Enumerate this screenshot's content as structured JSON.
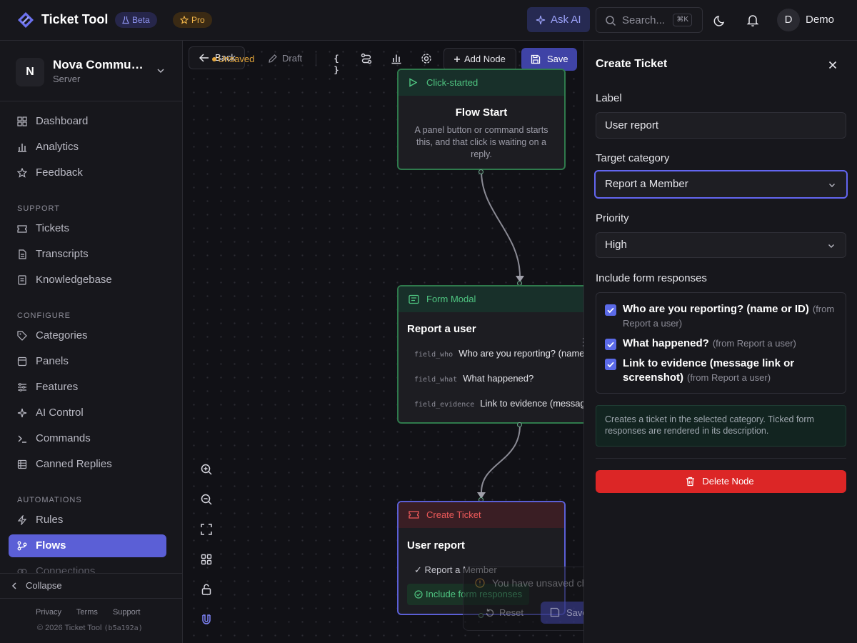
{
  "topbar": {
    "app_title": "Ticket Tool",
    "beta_badge": "Beta",
    "pro_badge": "Pro",
    "ask_ai_label": "Ask AI",
    "search_placeholder": "Search...",
    "search_shortcut": "⌘K",
    "user_initial": "D",
    "user_name": "Demo"
  },
  "sidebar": {
    "server_initial": "N",
    "server_name": "Nova Community",
    "server_type": "Server",
    "top_items": [
      {
        "label": "Dashboard",
        "icon": "dashboard-icon"
      },
      {
        "label": "Analytics",
        "icon": "bar-chart-icon"
      },
      {
        "label": "Feedback",
        "icon": "star-icon"
      }
    ],
    "sections": [
      {
        "title": "SUPPORT",
        "items": [
          {
            "label": "Tickets",
            "icon": "ticket-icon"
          },
          {
            "label": "Transcripts",
            "icon": "file-icon"
          },
          {
            "label": "Knowledgebase",
            "icon": "book-icon"
          }
        ]
      },
      {
        "title": "CONFIGURE",
        "items": [
          {
            "label": "Categories",
            "icon": "tag-icon"
          },
          {
            "label": "Panels",
            "icon": "panel-icon"
          },
          {
            "label": "Features",
            "icon": "sliders-icon"
          },
          {
            "label": "AI Control",
            "icon": "sparkle-icon"
          },
          {
            "label": "Commands",
            "icon": "terminal-icon"
          },
          {
            "label": "Canned Replies",
            "icon": "list-icon"
          }
        ]
      },
      {
        "title": "AUTOMATIONS",
        "items": [
          {
            "label": "Rules",
            "icon": "zap-icon"
          },
          {
            "label": "Flows",
            "icon": "flow-icon",
            "active": true
          },
          {
            "label": "Connections",
            "icon": "link-icon"
          }
        ]
      }
    ],
    "collapse_label": "Collapse",
    "footer_links": [
      "Privacy",
      "Terms",
      "Support"
    ],
    "copyright": "© 2026 Ticket Tool",
    "build": "(b5a192a)"
  },
  "canvas": {
    "back_label": "Back",
    "status_unsaved": "Unsaved",
    "status_draft": "Draft",
    "json_icon_text": "{ }",
    "add_node_label": "Add Node",
    "save_label": "Save",
    "nodes": {
      "start": {
        "type_label": "Click-started",
        "title": "Flow Start",
        "description": "A panel button or command starts this, and that click is waiting on a reply."
      },
      "form": {
        "type_label": "Form Modal",
        "title": "Report a user",
        "fields": [
          {
            "key": "field_who",
            "label": "Who are you reporting? (name or ID)"
          },
          {
            "key": "field_what",
            "label": "What happened?"
          },
          {
            "key": "field_evidence",
            "label": "Link to evidence (message link or screenshot)"
          }
        ]
      },
      "ticket": {
        "type_label": "Create Ticket",
        "title": "User report",
        "category_line": "✓ Report a Member",
        "include_label": "Include form responses"
      }
    },
    "unsaved_bar": {
      "message": "You have unsaved changes",
      "reset_label": "Reset",
      "save_changes_label": "Save Changes"
    }
  },
  "panel": {
    "title": "Create Ticket",
    "label_field": {
      "label": "Label",
      "value": "User report"
    },
    "category_field": {
      "label": "Target category",
      "value": "Report a Member"
    },
    "priority_field": {
      "label": "Priority",
      "value": "High"
    },
    "responses_label": "Include form responses",
    "responses": [
      {
        "question": "Who are you reporting? (name or ID)",
        "source": "(from Report a user)",
        "checked": true
      },
      {
        "question": "What happened?",
        "source": "(from Report a user)",
        "checked": true
      },
      {
        "question": "Link to evidence (message link or screenshot)",
        "source": "(from Report a user)",
        "checked": true
      }
    ],
    "info_text": "Creates a ticket in the selected category. Ticked form responses are rendered in its description.",
    "delete_label": "Delete Node"
  },
  "colors": {
    "accent": "#5b5fd6",
    "success": "#4fc581",
    "danger": "#dc2626",
    "warning": "#e3a53a"
  }
}
